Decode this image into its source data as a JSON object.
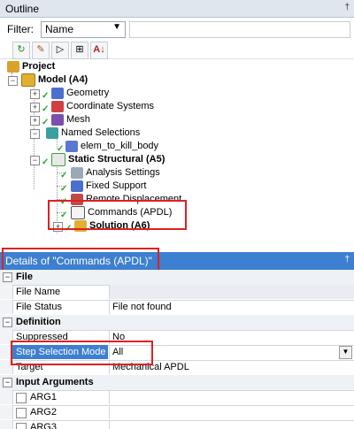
{
  "outline": {
    "title": "Outline",
    "pin": "†",
    "filter_label": "Filter:",
    "filter_value": "Name",
    "filter_arrow": "▼"
  },
  "toolbar": [
    "↻",
    "✎",
    "▷",
    "⊞",
    "A↓"
  ],
  "tree": {
    "project": "Project",
    "model": "Model (A4)",
    "geometry": "Geometry",
    "coord": "Coordinate Systems",
    "mesh": "Mesh",
    "named": "Named Selections",
    "elem": "elem_to_kill_body",
    "static": "Static Structural (A5)",
    "analysis": "Analysis Settings",
    "fixed": "Fixed Support",
    "remote": "Remote Displacement",
    "commands": "Commands (APDL)",
    "solution": "Solution (A6)"
  },
  "details": {
    "title": "Details of \"Commands (APDL)\"",
    "pin": "†",
    "groups": {
      "file": "File",
      "definition": "Definition",
      "input": "Input Arguments"
    },
    "rows": {
      "file_name": {
        "k": "File Name",
        "v": ""
      },
      "file_status": {
        "k": "File Status",
        "v": "File not found"
      },
      "suppressed": {
        "k": "Suppressed",
        "v": "No"
      },
      "step_mode": {
        "k": "Step Selection Mode",
        "v": "All"
      },
      "target": {
        "k": "Target",
        "v": "Mechanical APDL"
      },
      "arg1": "ARG1",
      "arg2": "ARG2",
      "arg3": "ARG3"
    },
    "minus": "−"
  },
  "colors": {
    "accent": "#3d7fd0",
    "highlight": "#e02020",
    "check": "#1ea820"
  }
}
